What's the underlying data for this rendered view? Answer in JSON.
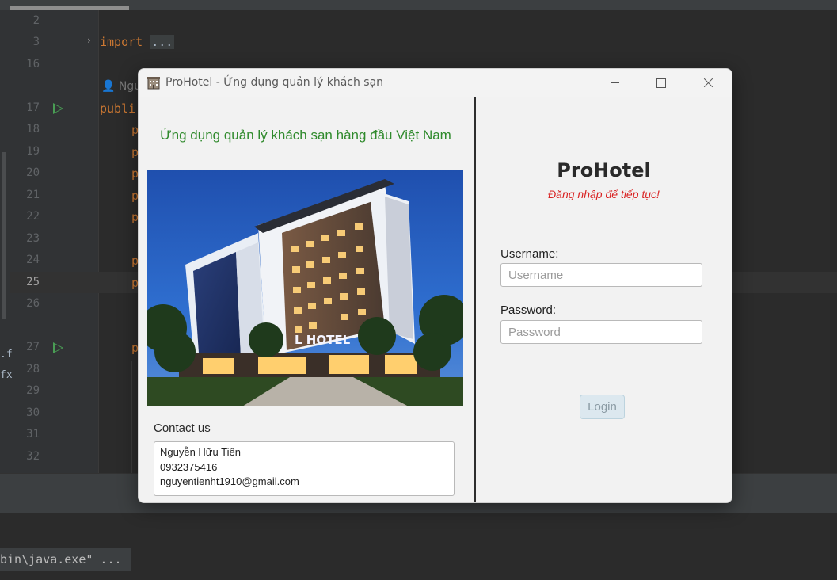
{
  "ide": {
    "line_numbers": [
      "2",
      "3",
      "16",
      "17",
      "18",
      "19",
      "20",
      "21",
      "22",
      "23",
      "24",
      "25",
      "26",
      "27",
      "28",
      "29",
      "30",
      "31",
      "32"
    ],
    "import_keyword": "import",
    "import_folded": "...",
    "author_hint": "Ngu",
    "public_fragment": "publi",
    "p_fragment": "p",
    "side_fragment_1": ".f",
    "side_fragment_2": "fx",
    "console_text": "bin\\java.exe\" ..."
  },
  "window": {
    "title": "ProHotel - Ứng dụng quản lý khách sạn",
    "icon": "hotel-building-icon"
  },
  "left_panel": {
    "tagline": "Ứng dụng quản lý khách sạn hàng đầu Việt Nam",
    "contact_label": "Contact us",
    "contact": {
      "name": "Nguyễn Hữu Tiến",
      "phone": "0932375416",
      "email": "nguyentienht1910@gmail.com"
    },
    "image_sign": "L HOTEL"
  },
  "login": {
    "brand": "ProHotel",
    "subtitle": "Đăng nhập để tiếp tục!",
    "username_label": "Username:",
    "username_placeholder": "Username",
    "password_label": "Password:",
    "password_placeholder": "Password",
    "login_button": "Login"
  },
  "colors": {
    "tagline": "#2f8a2c",
    "subtitle": "#d92222",
    "ide_background": "#2b2b2b",
    "keyword": "#cc7832"
  }
}
